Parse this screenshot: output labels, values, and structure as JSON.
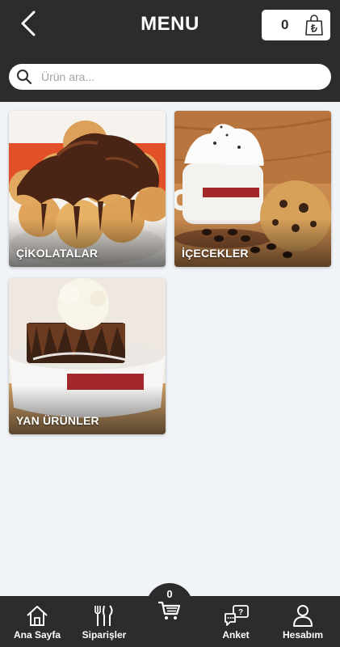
{
  "header": {
    "title": "MENU",
    "cart_count": "0",
    "currency_icon": "lira-shopping-bag-icon",
    "background": "#2d2c2c"
  },
  "search": {
    "placeholder": "Ürün ara...",
    "value": ""
  },
  "categories": [
    {
      "label": "ÇİKOLATALAR",
      "image": "chocolate-profiterole"
    },
    {
      "label": "İÇECEKLER",
      "image": "hot-drink-with-cookie"
    },
    {
      "label": "YAN ÜRÜNLER",
      "image": "brownie-with-ice-cream"
    }
  ],
  "bottom_nav": {
    "items": [
      {
        "label": "Ana Sayfa",
        "icon": "home-icon"
      },
      {
        "label": "Siparişler",
        "icon": "cutlery-icon"
      },
      {
        "label": "Anket",
        "icon": "survey-chat-icon"
      },
      {
        "label": "Hesabım",
        "icon": "user-icon"
      }
    ],
    "cart_count": "0",
    "cart_icon": "shopping-cart-icon"
  }
}
